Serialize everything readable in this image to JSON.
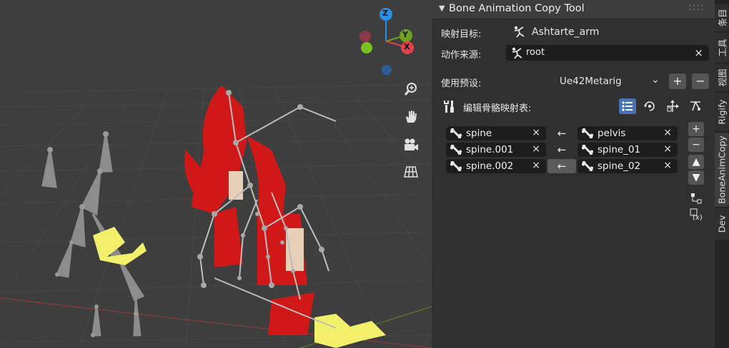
{
  "panel": {
    "title": "Bone Animation Copy Tool",
    "mapping_target_label": "映射目标:",
    "mapping_target_value": "Ashtarte_arm",
    "action_source_label": "动作来源:",
    "action_source_value": "root",
    "preset_label": "使用预设:",
    "preset_value": "Ue42Metarig",
    "edit_map_label": "编辑骨骼映射表:"
  },
  "bone_map": [
    {
      "target": "spine",
      "source": "pelvis"
    },
    {
      "target": "spine.001",
      "source": "spine_01"
    },
    {
      "target": "spine.002",
      "source": "spine_02"
    }
  ],
  "arrow_glyph": "←",
  "clear_glyph": "×",
  "tabs": [
    "条目",
    "工具",
    "视图",
    "Rigify",
    "BoneAnimCopy",
    "Dev"
  ],
  "active_tab": "BoneAnimCopy",
  "gizmo": {
    "z": "Z",
    "y": "Y",
    "x": "X"
  },
  "colors": {
    "accent_blue": "#4772b3",
    "axis_x": "#e0424b",
    "axis_y": "#70a020",
    "axis_z": "#2a8fe0"
  }
}
